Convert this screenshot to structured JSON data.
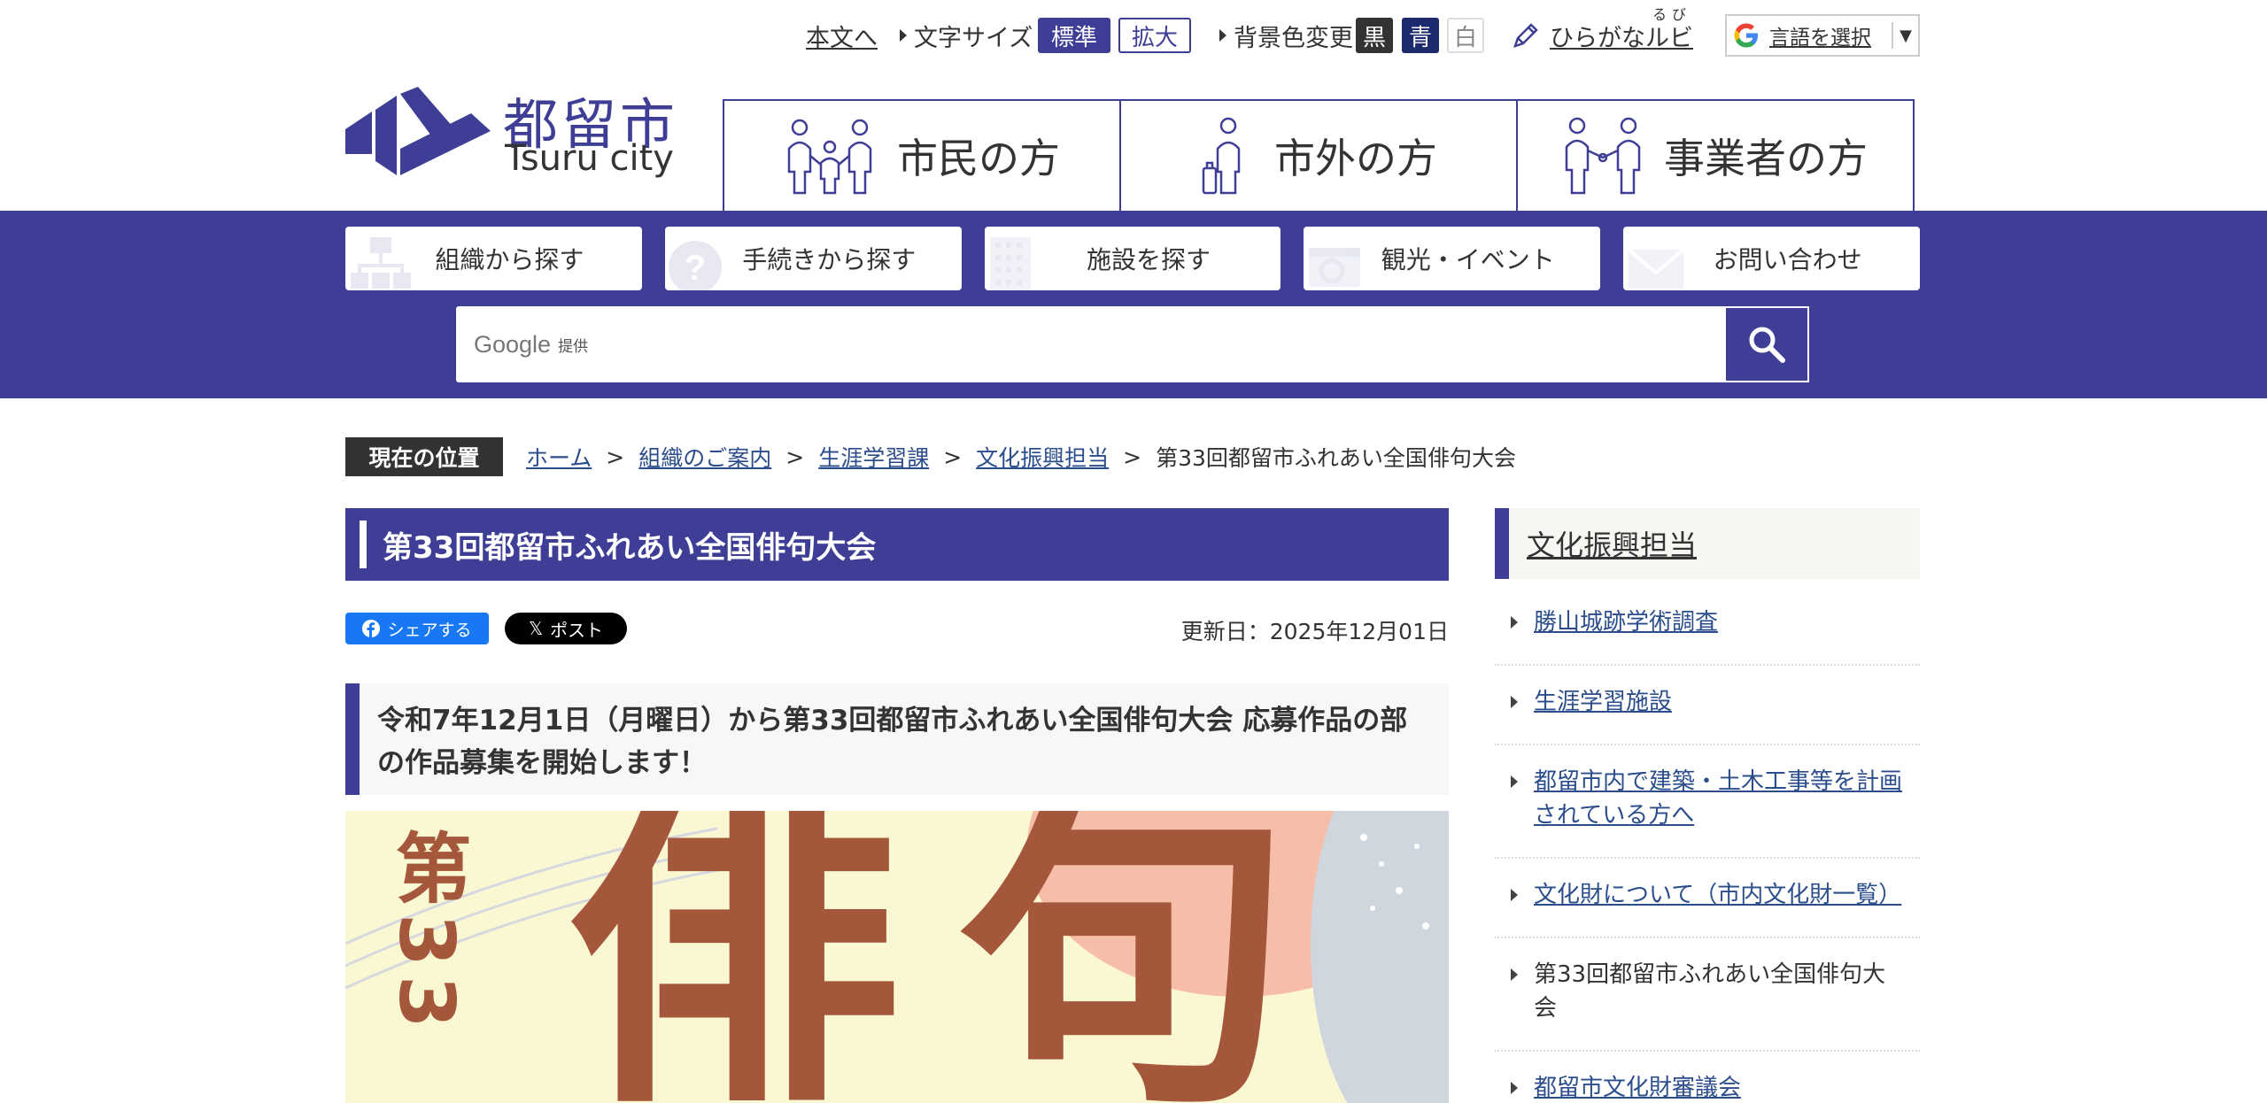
{
  "util": {
    "skip_link": "本文へ",
    "font_size_label": "文字サイズ",
    "font_std": "標準",
    "font_large": "拡大",
    "bg_label": "背景色変更",
    "bg_black": "黒",
    "bg_blue": "青",
    "bg_white": "白",
    "ruby_label": "ひらがなルビ",
    "ruby_furigana": "るび",
    "lang_label": "言語を選択",
    "lang_dropdown": "▼"
  },
  "logo": {
    "jp": "都留市",
    "en": "Tsuru city"
  },
  "categories": [
    {
      "label": "市民の方",
      "icon": "family-icon"
    },
    {
      "label": "市外の方",
      "icon": "traveler-icon"
    },
    {
      "label": "事業者の方",
      "icon": "handshake-icon"
    }
  ],
  "nav": [
    {
      "label": "組織から探す",
      "icon": "org-chart-icon"
    },
    {
      "label": "手続きから探す",
      "icon": "question-icon"
    },
    {
      "label": "施設を探す",
      "icon": "building-icon"
    },
    {
      "label": "観光・イベント",
      "icon": "camera-icon"
    },
    {
      "label": "お問い合わせ",
      "icon": "mail-icon"
    }
  ],
  "search": {
    "google": "Google",
    "teikyo": "提供"
  },
  "breadcrumb": {
    "here": "現在の位置",
    "items": [
      "ホーム",
      "組織のご案内",
      "生涯学習課",
      "文化振興担当"
    ],
    "current": "第33回都留市ふれあい全国俳句大会"
  },
  "main": {
    "title": "第33回都留市ふれあい全国俳句大会",
    "share_fb": "シェアする",
    "share_x": "ポスト",
    "updated": "更新日：2025年12月01日",
    "lead": "令和7年12月1日（月曜日）から第33回都留市ふれあい全国俳句大会 応募作品の部の作品募集を開始します！"
  },
  "poster": {
    "vertical": "第33",
    "big": "俳句"
  },
  "sidebar": {
    "heading": "文化振興担当",
    "items": [
      {
        "label": "勝山城跡学術調査",
        "link": true
      },
      {
        "label": "生涯学習施設",
        "link": true
      },
      {
        "label": "都留市内で建築・土木工事等を計画されている方へ",
        "link": true
      },
      {
        "label": "文化財について（市内文化財一覧）",
        "link": true
      },
      {
        "label": "第33回都留市ふれあい全国俳句大会",
        "link": false
      },
      {
        "label": "都留市文化財審議会",
        "link": true
      }
    ]
  },
  "colors": {
    "brand": "#3f3e96",
    "link": "#2b4d8c",
    "facebook": "#1877f2"
  }
}
